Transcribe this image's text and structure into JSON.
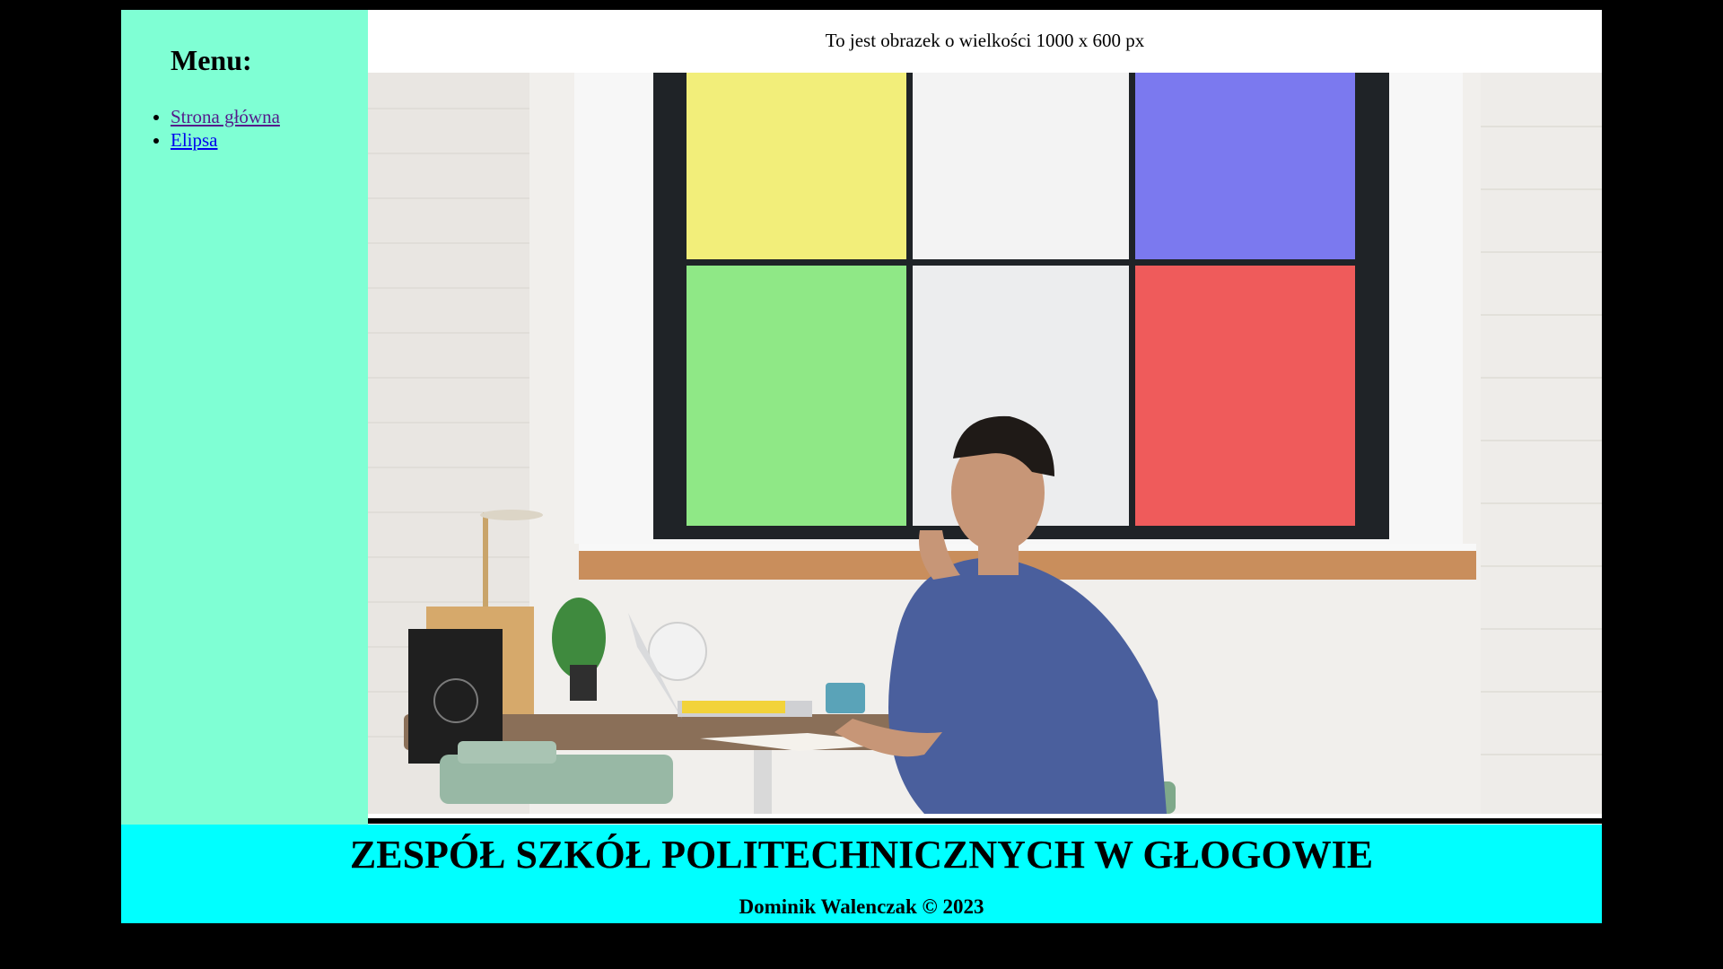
{
  "colors": {
    "background": "#000000",
    "sidebar_bg": "#7fffd4",
    "footer_bg": "#00ffff",
    "link": "#0000ee",
    "link_visited": "#551a8b"
  },
  "sidebar": {
    "heading": "Menu:",
    "items": [
      {
        "label": "Strona główna",
        "state": "visited"
      },
      {
        "label": "Elipsa",
        "state": "unvisited"
      }
    ]
  },
  "main": {
    "caption": "To jest obrazek o wielkości 1000 x 600 px",
    "image": {
      "subject": "man at desk with laptop in front of colorful window",
      "window_pane_colors": [
        "#f2ee7a",
        "#f3f3f3",
        "#7b79ef",
        "#8fe886",
        "#f0f0f0",
        "#ef5b5b"
      ]
    }
  },
  "footer": {
    "title": "ZESPÓŁ SZKÓŁ POLITECHNICZNYCH W GŁOGOWIE",
    "credit": "Dominik Walenczak © 2023"
  }
}
